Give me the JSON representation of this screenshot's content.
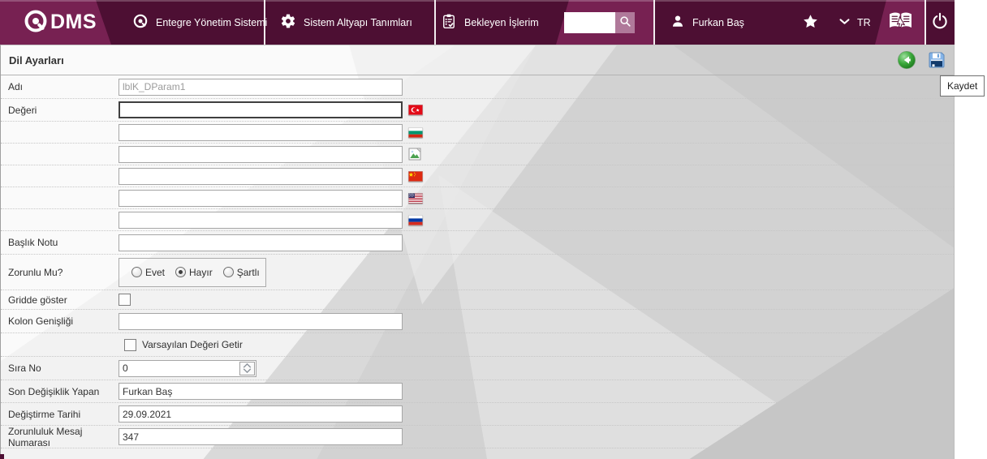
{
  "colors": {
    "topbar_dark": "#4d0f33",
    "topbar_light": "#772152",
    "search_button": "#b0799a",
    "focus_border": "#3f3f3f"
  },
  "topbar": {
    "logo_text": "DMS",
    "menu_items": [
      {
        "label": "Entegre Yönetim Sistemi",
        "icon": "qdms-circle-icon"
      },
      {
        "label": "Sistem Altyapı Tanımları",
        "icon": "gear-icon"
      },
      {
        "label": "Bekleyen İşlerim",
        "icon": "clipboard-check-icon"
      }
    ],
    "search": {
      "value": "",
      "icon": "search-icon"
    },
    "user_name": "Furkan Baş",
    "language_code": "TR",
    "icons": [
      "star-icon",
      "chevron-down-icon",
      "book-pointer-icon",
      "power-icon"
    ]
  },
  "page": {
    "title": "Dil Ayarları",
    "toolbar": {
      "back_icon": "back-icon",
      "save_icon": "save-icon"
    },
    "save_tooltip": "Kaydet"
  },
  "form": {
    "adi": {
      "label": "Adı",
      "value": "lblK_DParam1",
      "disabled": true
    },
    "degeri": {
      "label": "Değeri",
      "values": [
        "",
        "",
        "",
        "",
        "",
        ""
      ],
      "flags": [
        "turkey-flag",
        "bulgaria-flag",
        "missing-image",
        "china-flag",
        "usa-flag",
        "russia-flag"
      ]
    },
    "baslik_notu": {
      "label": "Başlık Notu",
      "value": ""
    },
    "zorunlu_mu": {
      "label": "Zorunlu Mu?",
      "options": [
        "Evet",
        "Hayır",
        "Şartlı"
      ],
      "selected": "Hayır"
    },
    "gridde_goster": {
      "label": "Gridde göster",
      "checked": false
    },
    "kolon_genisligi": {
      "label": "Kolon Genişliği",
      "value": ""
    },
    "varsayilan": {
      "label": "Varsayılan Değeri Getir",
      "checked": false
    },
    "sira_no": {
      "label": "Sıra No",
      "value": "0"
    },
    "son_degisiklik_yapan": {
      "label": "Son Değişiklik Yapan",
      "value": "Furkan Baş"
    },
    "degistirme_tarihi": {
      "label": "Değiştirme Tarihi",
      "value": "29.09.2021"
    },
    "zorunluluk_mesaj_numarasi": {
      "label": "Zorunluluk Mesaj Numarası",
      "value": "347"
    }
  }
}
